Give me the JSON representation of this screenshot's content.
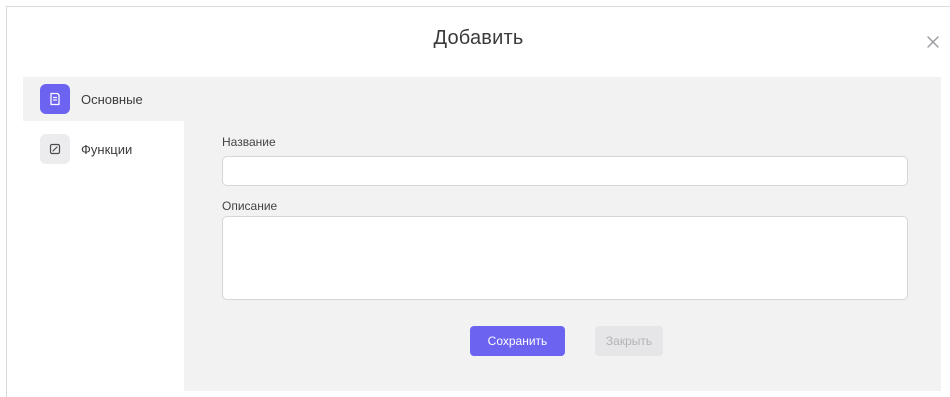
{
  "dialog": {
    "title": "Добавить",
    "close_icon": "close-icon"
  },
  "sidebar": {
    "items": [
      {
        "label": "Основные",
        "icon": "document-icon",
        "active": true
      },
      {
        "label": "Функции",
        "icon": "edit-icon",
        "active": false
      }
    ]
  },
  "form": {
    "name_label": "Название",
    "name_value": "",
    "description_label": "Описание",
    "description_value": ""
  },
  "actions": {
    "save_label": "Сохранить",
    "close_label": "Закрыть"
  },
  "colors": {
    "accent": "#6c63f0",
    "panel_bg": "#f2f2f3",
    "disabled_bg": "#e6e6e8",
    "disabled_text": "#b3b3b8"
  }
}
